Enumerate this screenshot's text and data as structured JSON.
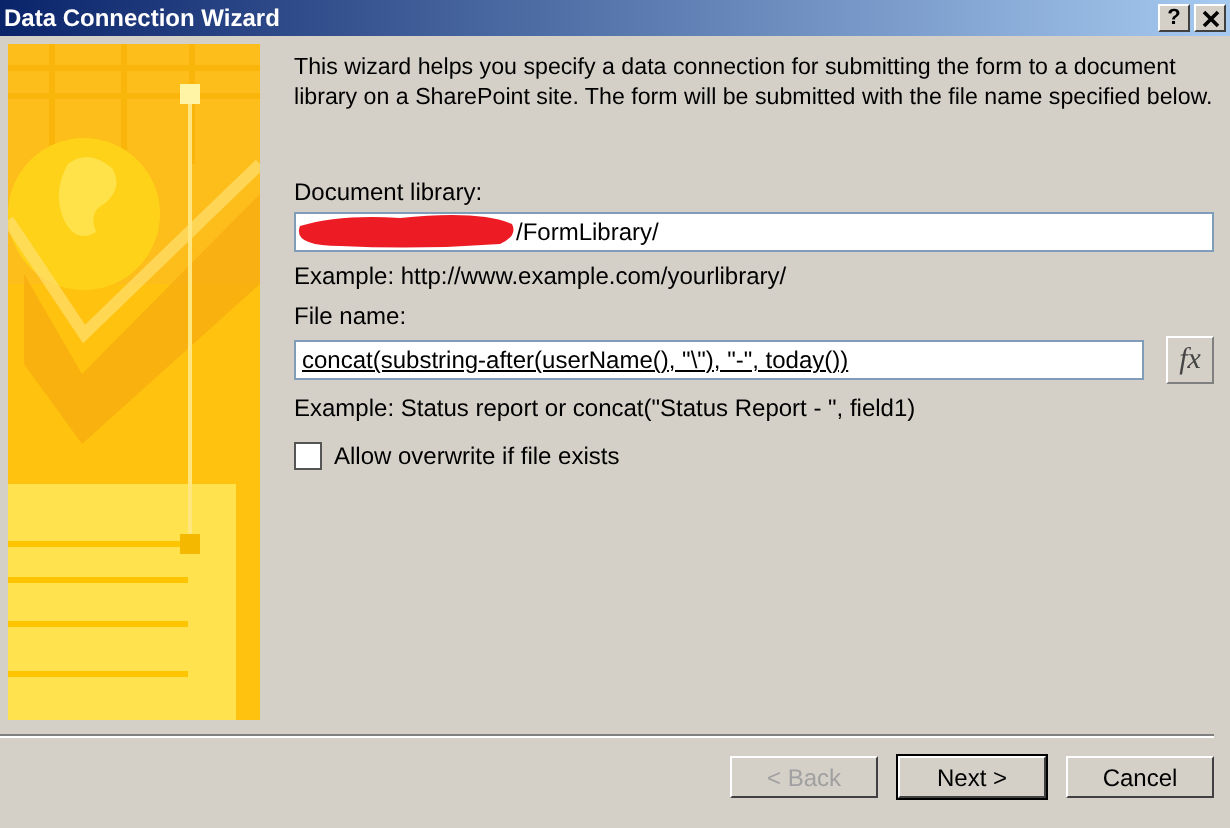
{
  "window": {
    "title": "Data Connection Wizard",
    "help_button": "?"
  },
  "description": "This wizard helps you specify a data connection for submitting the form to a document library on a SharePoint site. The form will be submitted with the file name specified below.",
  "fields": [
    {
      "label": "Document library:",
      "value": "/FormLibrary/",
      "redacted": true,
      "hint": "Example: http://www.example.com/yourlibrary/"
    },
    {
      "label": "File name:",
      "value": "concat(substring-after(userName(), \"\\\"), \"-\", today())",
      "formula_button": "fx",
      "hint": "Example: Status report or concat(\"Status Report - \", field1)"
    }
  ],
  "checkbox": {
    "label": "Allow overwrite if file exists",
    "checked": false
  },
  "buttons": [
    {
      "label": "< Back",
      "disabled": true,
      "default": false
    },
    {
      "label": "Next >",
      "disabled": false,
      "default": true
    },
    {
      "label": "Cancel",
      "disabled": false,
      "default": false
    }
  ]
}
